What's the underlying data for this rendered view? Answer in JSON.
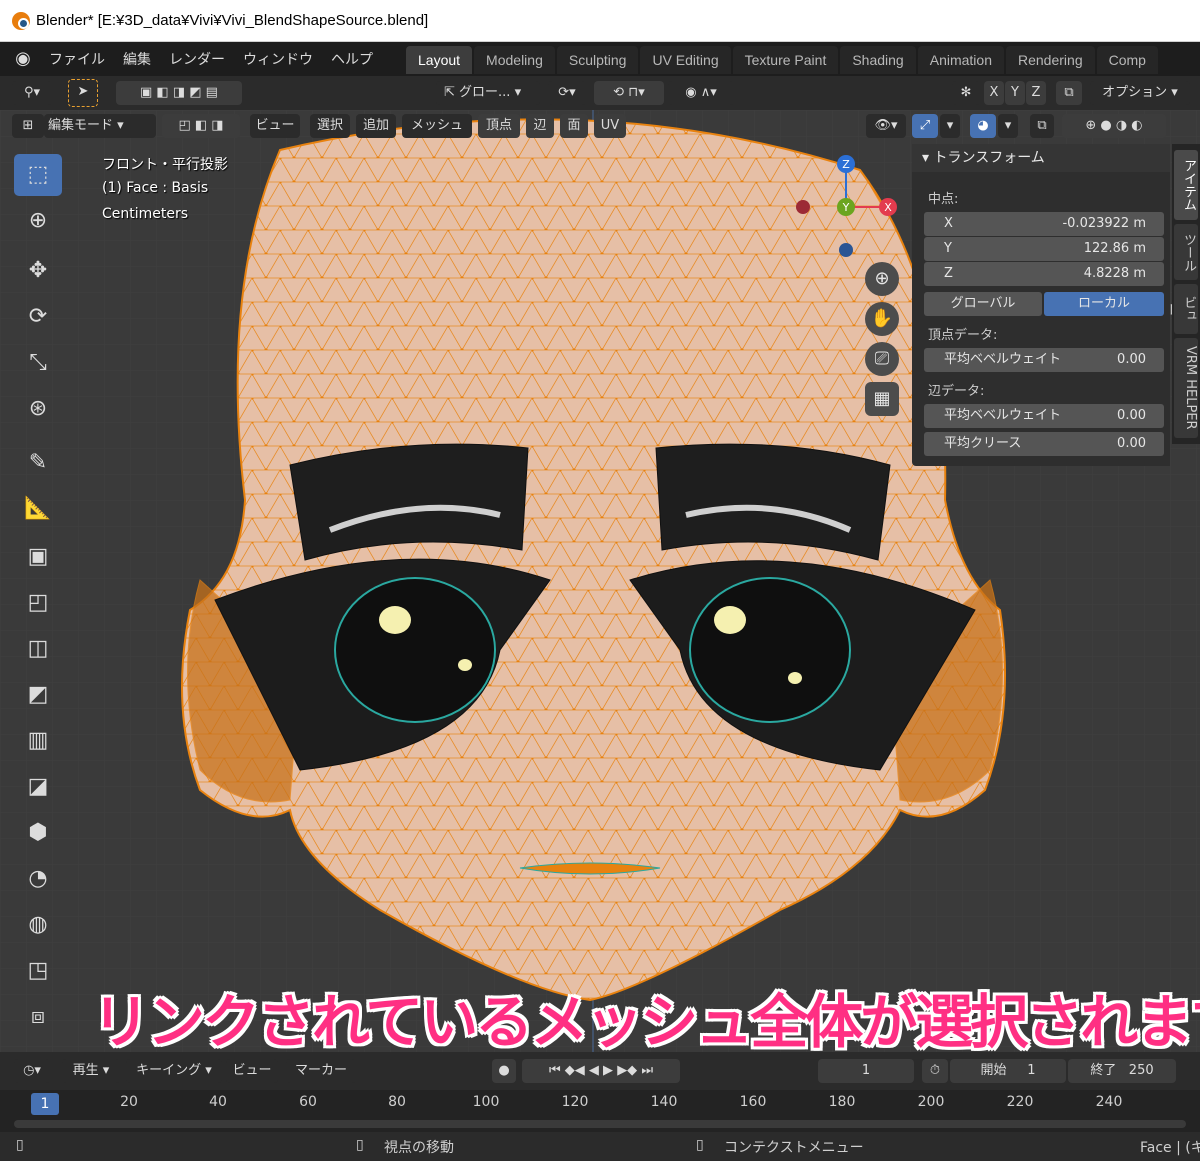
{
  "window": {
    "title": "Blender* [E:¥3D_data¥Vivi¥Vivi_BlendShapeSource.blend]"
  },
  "menu": {
    "items": [
      "ファイル",
      "編集",
      "レンダー",
      "ウィンドウ",
      "ヘルプ"
    ]
  },
  "workspaces": {
    "tabs": [
      "Layout",
      "Modeling",
      "Sculpting",
      "UV Editing",
      "Texture Paint",
      "Shading",
      "Animation",
      "Rendering",
      "Comp"
    ],
    "active": "Layout"
  },
  "tool_header": {
    "transform_orientation": "グロー...",
    "axes": [
      "X",
      "Y",
      "Z"
    ],
    "options": "オプション"
  },
  "viewport_header": {
    "mode": "編集モード",
    "menus": [
      "ビュー",
      "選択",
      "追加",
      "メッシュ",
      "頂点",
      "辺",
      "面",
      "UV"
    ]
  },
  "viewport_overlay": {
    "view_name": "フロント・平行投影",
    "object_info": "(1) Face : Basis",
    "units": "Centimeters"
  },
  "gizmo": {
    "axes": [
      "Z",
      "Y",
      "X"
    ]
  },
  "transform_panel": {
    "title": "トランスフォーム",
    "median_label": "中点:",
    "x_label": "X",
    "x_value": "-0.023922 m",
    "y_label": "Y",
    "y_value": "122.86 m",
    "z_label": "Z",
    "z_value": "4.8228 m",
    "global_label": "グローバル",
    "local_label": "ローカル",
    "vertex_data_label": "頂点データ:",
    "vertex_bevel_label": "平均ベベルウェイト",
    "vertex_bevel_value": "0.00",
    "edge_data_label": "辺データ:",
    "edge_bevel_label": "平均ベベルウェイト",
    "edge_bevel_value": "0.00",
    "edge_crease_label": "平均クリース",
    "edge_crease_value": "0.00"
  },
  "side_tabs": [
    "アイテム",
    "ツール",
    "ビュー",
    "VRM HELPER"
  ],
  "caption": "リンクされているメッシュ全体が選択されます",
  "timeline": {
    "menus": [
      "再生",
      "キーイング",
      "ビュー",
      "マーカー"
    ],
    "current_frame": "1",
    "start_label": "開始",
    "start_value": "1",
    "end_label": "終了",
    "end_value": "250",
    "ticks": [
      "1",
      "20",
      "40",
      "60",
      "80",
      "100",
      "120",
      "140",
      "160",
      "180",
      "200",
      "220",
      "240"
    ]
  },
  "statusbar": {
    "view_move": "視点の移動",
    "context_menu": "コンテクストメニュー",
    "right_text": "Face | (キ"
  },
  "colors": {
    "accent": "#4772b3",
    "selected_mesh": "#e87d0d",
    "caption": "#ff2f83"
  }
}
